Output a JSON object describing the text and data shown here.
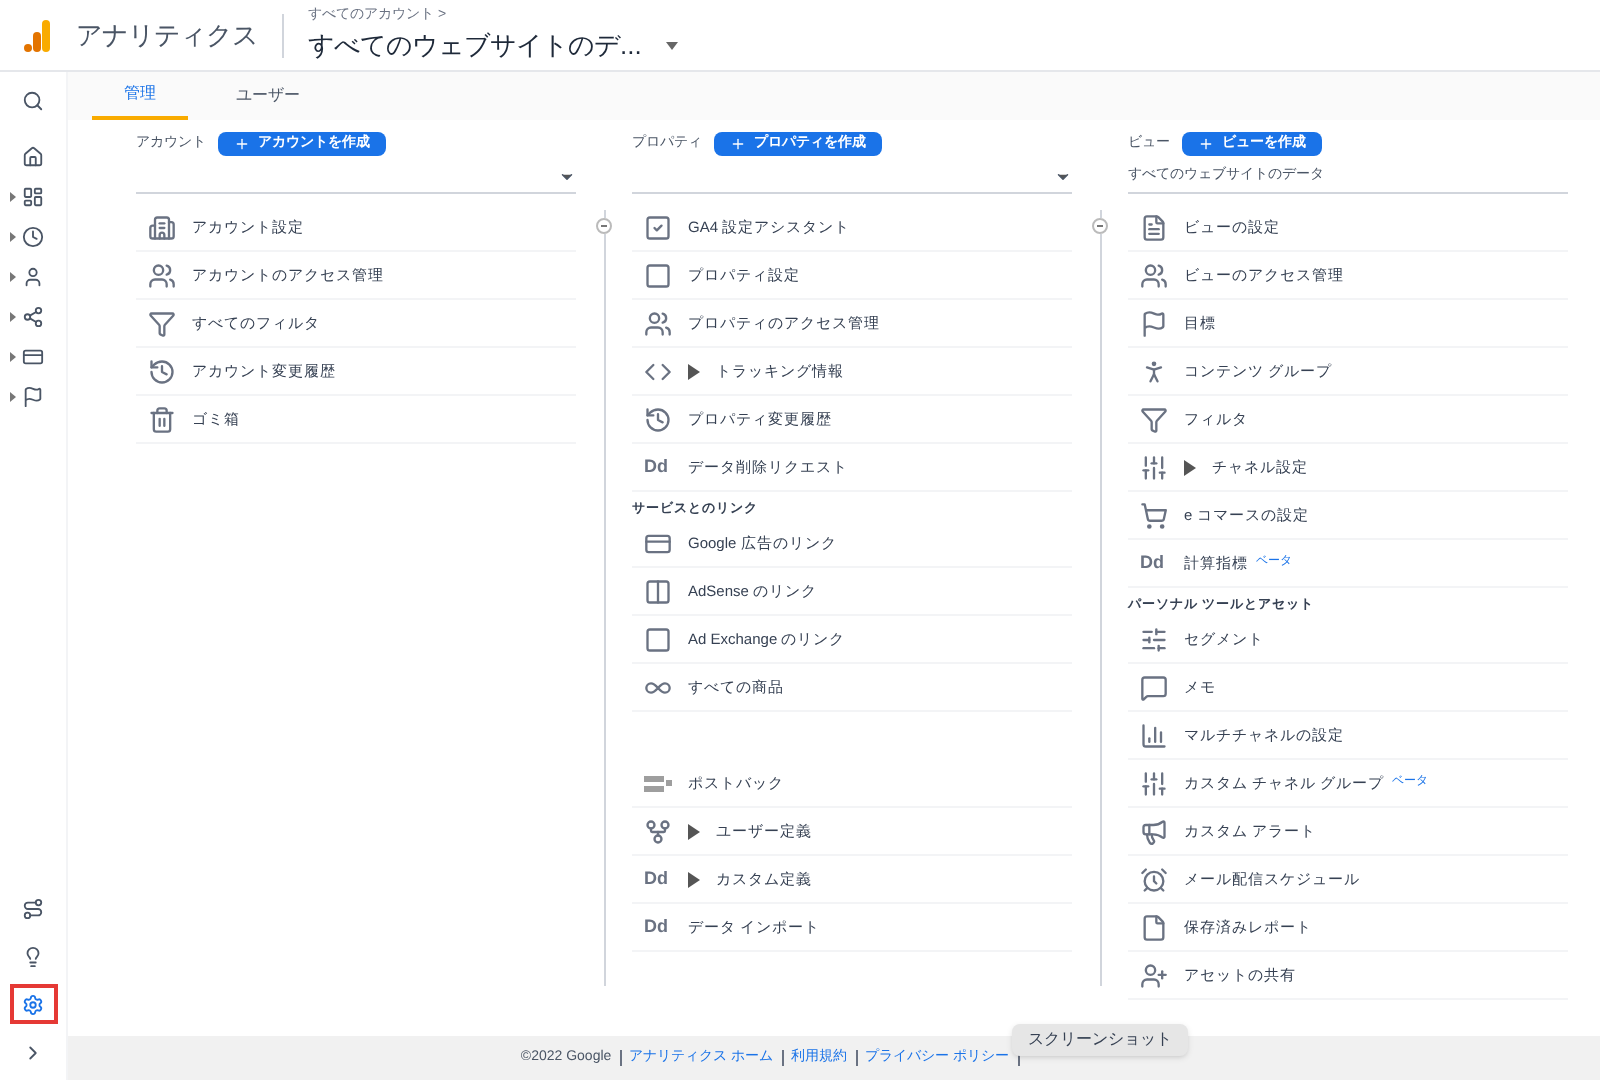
{
  "header": {
    "app_name": "アナリティクス",
    "breadcrumb": "すべてのアカウント >",
    "view_title": "すべてのウェブサイトのデ..."
  },
  "sidebar": {
    "top": [
      {
        "expandable": false
      },
      {
        "expandable": false
      },
      {
        "expandable": true
      },
      {
        "expandable": true
      },
      {
        "expandable": true
      },
      {
        "expandable": true
      },
      {
        "expandable": true
      },
      {
        "expandable": true
      }
    ],
    "bottom": [
      {
        "highlighted": false
      },
      {
        "highlighted": false
      },
      {
        "highlighted": true
      },
      {
        "highlighted": false
      }
    ]
  },
  "tabs": [
    {
      "label": "管理",
      "selected": true
    },
    {
      "label": "ユーザー",
      "selected": false
    }
  ],
  "columns": [
    {
      "label": "アカウント",
      "create_button": "アカウントを作成",
      "selector": {
        "has_caret": true
      },
      "sections": [
        {
          "items": [
            {
              "label": "アカウント設定",
              "expandable": false
            },
            {
              "label": "アカウントのアクセス管理",
              "expandable": false
            },
            {
              "label": "すべてのフィルタ",
              "expandable": false
            },
            {
              "label": "アカウント変更履歴",
              "expandable": false
            },
            {
              "label": "ゴミ箱",
              "expandable": false
            }
          ]
        }
      ]
    },
    {
      "label": "プロパティ",
      "create_button": "プロパティを作成",
      "selector": {
        "has_caret": true
      },
      "sections": [
        {
          "items": [
            {
              "label": "GA4 設定アシスタント",
              "expandable": false
            },
            {
              "label": "プロパティ設定",
              "expandable": false
            },
            {
              "label": "プロパティのアクセス管理",
              "expandable": false
            },
            {
              "label": "トラッキング情報",
              "expandable": true
            },
            {
              "label": "プロパティ変更履歴",
              "expandable": false
            },
            {
              "label": "データ削除リクエスト",
              "expandable": false,
              "icon_text": "Dd"
            }
          ]
        },
        {
          "heading": "サービスとのリンク",
          "items": [
            {
              "label": "Google 広告のリンク",
              "expandable": false
            },
            {
              "label": "AdSense のリンク",
              "expandable": false
            },
            {
              "label": "Ad Exchange のリンク",
              "expandable": false
            },
            {
              "label": "すべての商品",
              "expandable": false
            }
          ]
        },
        {
          "gap": true,
          "items": [
            {
              "label": "ポストバック",
              "expandable": false
            },
            {
              "label": "ユーザー定義",
              "expandable": true
            },
            {
              "label": "カスタム定義",
              "expandable": true,
              "icon_text": "Dd"
            },
            {
              "label": "データ インポート",
              "expandable": false,
              "icon_text": "Dd"
            }
          ]
        }
      ]
    },
    {
      "label": "ビュー",
      "create_button": "ビューを作成",
      "selector": {
        "value": "すべてのウェブサイトのデータ",
        "has_caret": false
      },
      "sections": [
        {
          "items": [
            {
              "label": "ビューの設定",
              "expandable": false
            },
            {
              "label": "ビューのアクセス管理",
              "expandable": false
            },
            {
              "label": "目標",
              "expandable": false
            },
            {
              "label": "コンテンツ グループ",
              "expandable": false
            },
            {
              "label": "フィルタ",
              "expandable": false
            },
            {
              "label": "チャネル設定",
              "expandable": true
            },
            {
              "label": "e コマースの設定",
              "expandable": false
            },
            {
              "label": "計算指標",
              "expandable": false,
              "badge": "ベータ",
              "icon_text": "Dd"
            }
          ]
        },
        {
          "heading": "パーソナル ツールとアセット",
          "items": [
            {
              "label": "セグメント",
              "expandable": false
            },
            {
              "label": "メモ",
              "expandable": false
            },
            {
              "label": "マルチチャネルの設定",
              "expandable": false
            },
            {
              "label": "カスタム チャネル グループ",
              "expandable": false,
              "badge": "ベータ"
            },
            {
              "label": "カスタム アラート",
              "expandable": false
            },
            {
              "label": "メール配信スケジュール",
              "expandable": false
            },
            {
              "label": "保存済みレポート",
              "expandable": false
            },
            {
              "label": "アセットの共有",
              "expandable": false
            }
          ]
        }
      ]
    }
  ],
  "footer": {
    "copyright": "©2022 Google",
    "links": [
      "アナリティクス ホーム",
      "利用規約",
      "プライバシー ポリシー"
    ]
  },
  "tooltip": "スクリーンショット"
}
